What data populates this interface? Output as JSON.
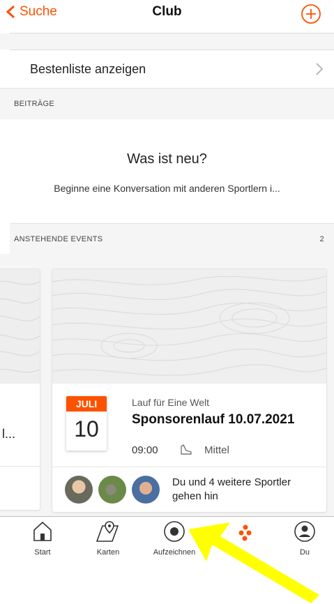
{
  "header": {
    "back_label": "Suche",
    "title": "Club"
  },
  "leaderboard": {
    "label": "Bestenliste anzeigen"
  },
  "posts": {
    "section_label": "BEITRÄGE",
    "empty_title": "Was ist neu?",
    "empty_text": "Beginne eine Konversation mit anderen Sportlern i..."
  },
  "events": {
    "section_label": "ANSTEHENDE EVENTS",
    "count": "2",
    "prev_card_text": "l...",
    "card": {
      "month": "JULI",
      "day": "10",
      "subtitle": "Lauf für Eine Welt",
      "title": "Sponsorenlauf 10.07.2021",
      "time": "09:00",
      "level": "Mittel",
      "attendees_text": "Du und 4 weitere Sportler gehen hin"
    }
  },
  "tabbar": {
    "items": [
      {
        "label": "Start",
        "icon": "home-icon"
      },
      {
        "label": "Karten",
        "icon": "map-icon"
      },
      {
        "label": "Aufzeichnen",
        "icon": "record-icon"
      },
      {
        "label": "",
        "icon": "groups-icon"
      },
      {
        "label": "Du",
        "icon": "profile-icon"
      }
    ]
  },
  "colors": {
    "accent": "#fc5200",
    "annotation_arrow": "#ffff00"
  }
}
